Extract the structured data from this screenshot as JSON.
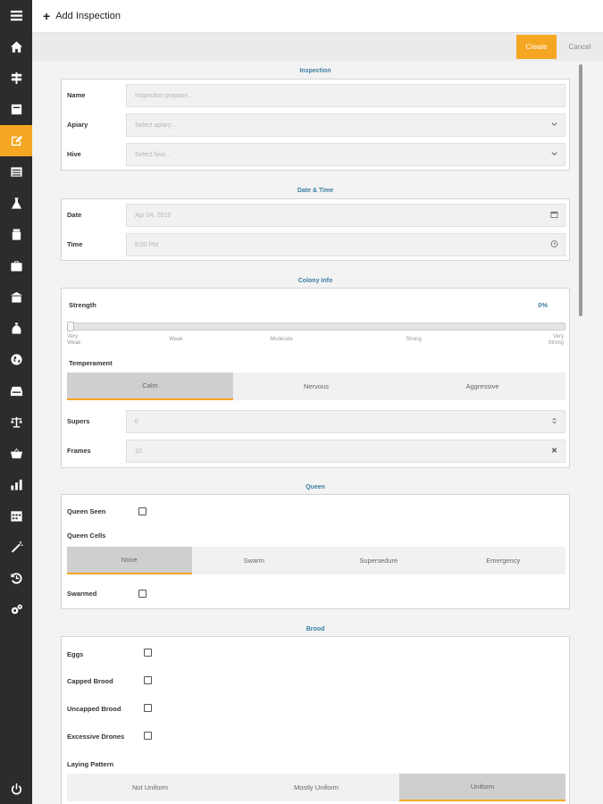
{
  "header": {
    "title": "Add Inspection"
  },
  "toolbar": {
    "create_label": "Create",
    "cancel_label": "Cancel"
  },
  "inspection": {
    "title": "Inspection",
    "name_label": "Name",
    "name_placeholder": "Inspection purpose...",
    "apiary_label": "Apiary",
    "apiary_placeholder": "Select apiary...",
    "hive_label": "Hive",
    "hive_placeholder": "Select hive..."
  },
  "datetime": {
    "title": "Date & Time",
    "date_label": "Date",
    "date_value": "Apr 04, 2019",
    "time_label": "Time",
    "time_value": "8:50 PM"
  },
  "colony": {
    "title": "Colony Info",
    "strength_label": "Strength",
    "strength_value": "0%",
    "strength_percent": 0,
    "strength_ticks": [
      "Very Weak",
      "Weak",
      "Moderate",
      "Strong",
      "Very Strong"
    ],
    "temperament_label": "Temperament",
    "temperament_options": [
      "Calm",
      "Nervous",
      "Aggressive"
    ],
    "temperament_selected": 0,
    "supers_label": "Supers",
    "supers_value": "0",
    "frames_label": "Frames",
    "frames_value": "10"
  },
  "queen": {
    "title": "Queen",
    "queen_seen_label": "Queen Seen",
    "queen_cells_label": "Queen Cells",
    "queen_cells_options": [
      "None",
      "Swarm",
      "Supersedure",
      "Emergency"
    ],
    "queen_cells_selected": 0,
    "swarmed_label": "Swarmed"
  },
  "brood": {
    "title": "Brood",
    "eggs_label": "Eggs",
    "capped_label": "Capped Brood",
    "uncapped_label": "Uncapped Brood",
    "drones_label": "Excessive Drones",
    "laying_label": "Laying Pattern",
    "laying_options": [
      "Not Uniform",
      "Mostly Uniform",
      "Uniform"
    ],
    "laying_selected": 2
  },
  "colors": {
    "accent": "#f5a623",
    "sidebar": "#2c2c2c",
    "section_title": "#3a7ea0"
  },
  "sidebar_icons": [
    "menu-icon",
    "home-icon",
    "signpost-icon",
    "note-icon",
    "edit-icon",
    "list-icon",
    "flask-icon",
    "jar-icon",
    "briefcase-icon",
    "hive-icon",
    "bag-icon",
    "globe-icon",
    "inbox-icon",
    "balance-icon",
    "basket-icon",
    "bar-chart-icon",
    "calendar-icon",
    "magic-wand-icon",
    "history-icon",
    "cogs-icon",
    "power-icon"
  ]
}
